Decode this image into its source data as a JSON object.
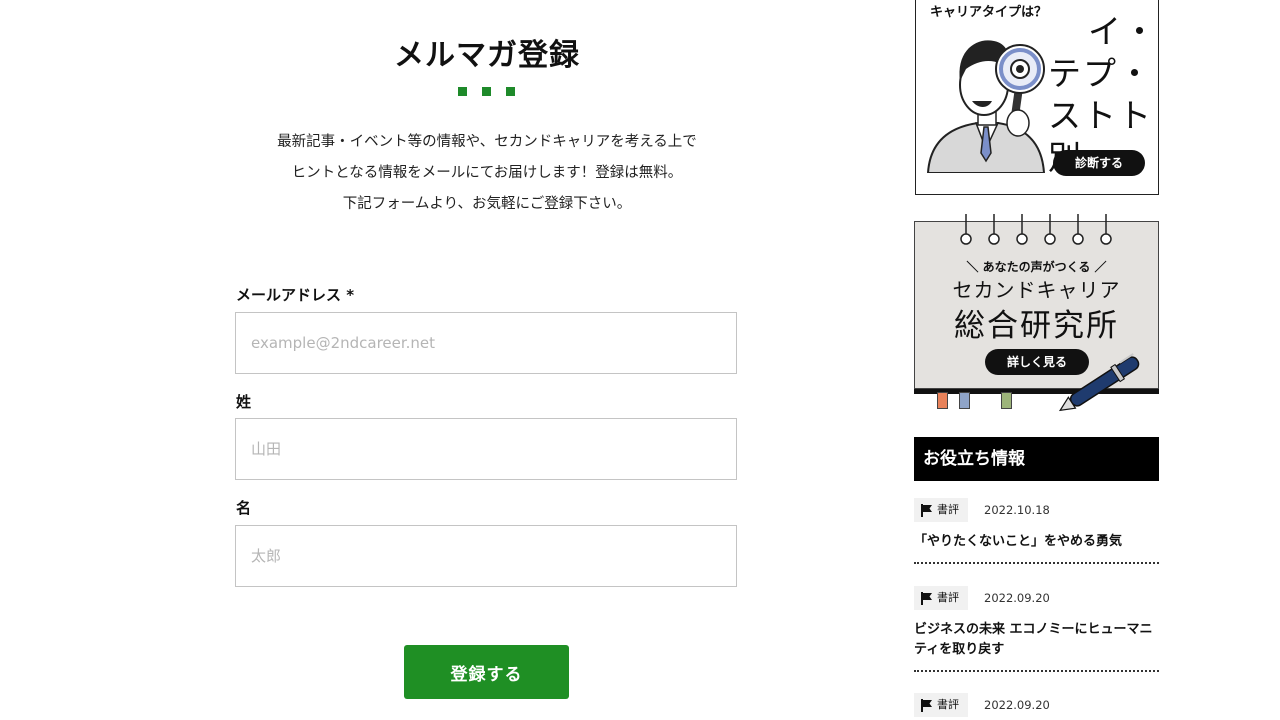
{
  "main": {
    "title": "メルマガ登録",
    "intro": [
      "最新記事・イベント等の情報や、セカンドキャリアを考える上で",
      "ヒントとなる情報をメールにてお届けします！登録は無料。",
      "下記フォームより、お気軽にご登録下さい。"
    ],
    "form": {
      "email": {
        "label": "メールアドレス *",
        "placeholder": "example@2ndcareer.net",
        "value": ""
      },
      "last_name": {
        "label": "姓",
        "placeholder": "山田",
        "value": ""
      },
      "first_name": {
        "label": "名",
        "placeholder": "太郎",
        "value": ""
      },
      "submit_label": "登録する"
    },
    "accent_color": "#1f8f24"
  },
  "sidebar": {
    "diagnosis_banner": {
      "subtitle": "キャリアタイプは？",
      "heading_lines": [
        "イ・",
        "テプ・",
        "ストト別・"
      ],
      "cta": "診断する"
    },
    "research_banner": {
      "small": "＼ あなたの声がつくる ／",
      "line1": "セカンドキャリア",
      "line2": "総合研究所",
      "cta": "詳しく見る"
    },
    "useful_info": {
      "title": "お役立ち情報",
      "posts": [
        {
          "tag": "書評",
          "date": "2022.10.18",
          "title": "「やりたくないこと」をやめる勇気"
        },
        {
          "tag": "書評",
          "date": "2022.09.20",
          "title": "ビジネスの未来 エコノミーにヒューマニティを取り戻す"
        },
        {
          "tag": "書評",
          "date": "2022.09.20",
          "title": ""
        }
      ]
    }
  }
}
